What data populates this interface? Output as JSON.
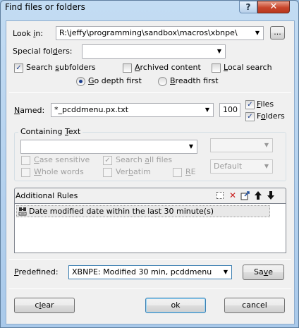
{
  "window": {
    "title": "Find files or folders",
    "help_label": "?",
    "close_label": "✕"
  },
  "look_in": {
    "label_pre": "Look ",
    "label_u": "i",
    "label_post": "n:",
    "value": "R:\\jeffy\\programming\\sandbox\\macros\\xbnpe\\",
    "browse_label": "..."
  },
  "special_folders": {
    "label_pre": "Special fol",
    "label_u": "d",
    "label_post": "ers:",
    "value": ""
  },
  "search_options": {
    "subfolders": {
      "label_pre": "Search ",
      "label_u": "s",
      "label_post": "ubfolders",
      "checked": true
    },
    "archived": {
      "label_pre": "",
      "label_u": "A",
      "label_post": "rchived content",
      "checked": false
    },
    "local": {
      "label_pre": "",
      "label_u": "L",
      "label_post": "ocal search",
      "checked": false
    },
    "depth_first": {
      "label_pre": "",
      "label_u": "G",
      "label_post": "o depth first",
      "selected": true
    },
    "breadth_first": {
      "label_pre": "",
      "label_u": "B",
      "label_post": "readth first",
      "selected": false
    }
  },
  "named": {
    "label_pre": "",
    "label_u": "N",
    "label_post": "amed:",
    "value": "*_pcddmenu.px.txt",
    "limit": "100",
    "files": {
      "label_pre": "",
      "label_u": "F",
      "label_post": "iles",
      "checked": true
    },
    "folders": {
      "label_pre": "F",
      "label_u": "o",
      "label_post": "lders",
      "checked": true
    }
  },
  "containing_text": {
    "label_pre": "Containing ",
    "label_u": "T",
    "label_post": "ext",
    "value": "",
    "encoding_value": "",
    "case_sensitive": {
      "label_pre": "",
      "label_u": "C",
      "label_post": "ase sensitive",
      "checked": false
    },
    "search_all_files": {
      "label_pre": "Search ",
      "label_u": "a",
      "label_post": "ll files",
      "checked": true
    },
    "whole_words": {
      "label_pre": "",
      "label_u": "W",
      "label_post": "hole words",
      "checked": false
    },
    "verbatim": {
      "label_pre": "Ver",
      "label_u": "b",
      "label_post": "atim",
      "checked": false
    },
    "re": {
      "label_pre": "",
      "label_u": "R",
      "label_post": "E",
      "checked": false
    },
    "mode_value": "Default"
  },
  "additional_rules": {
    "label": "Additional Rules",
    "tool_icons": [
      "new-icon",
      "delete-icon",
      "properties-icon",
      "move-up-icon",
      "move-down-icon"
    ],
    "items": [
      {
        "text": "Date modified date within the last 30 minute(s)",
        "icon": "rule-icon"
      }
    ]
  },
  "predefined": {
    "label_pre": "",
    "label_u": "P",
    "label_post": "redefined:",
    "value": "XBNPE: Modified 30 min, pcddmenu",
    "save_pre": "Sa",
    "save_u": "v",
    "save_post": "e"
  },
  "buttons": {
    "clear_pre": "c",
    "clear_u": "l",
    "clear_post": "ear",
    "ok": "ok",
    "cancel": "cancel"
  }
}
